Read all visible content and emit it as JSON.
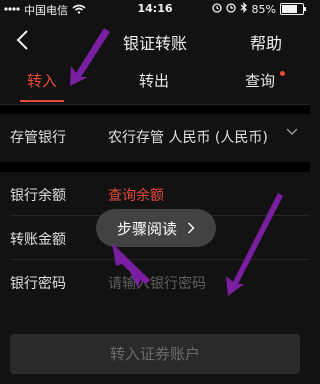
{
  "status_bar": {
    "carrier": "中国电信",
    "time": "14:16",
    "battery_percent": "85%",
    "battery_level": 0.85,
    "icons": [
      "signal-bars-icon",
      "wifi-icon",
      "alarm-icon",
      "clock-icon",
      "bluetooth-icon",
      "battery-icon"
    ]
  },
  "nav": {
    "title": "银证转账",
    "help_label": "帮助",
    "back_icon": "chevron-left-icon"
  },
  "tabs": [
    {
      "label": "转入",
      "active": true
    },
    {
      "label": "转出",
      "active": false
    },
    {
      "label": "查询",
      "active": false,
      "badge_dot": true
    }
  ],
  "form": {
    "bank": {
      "label": "存管银行",
      "value": "农行存管 人民币 (人民币)"
    },
    "balance": {
      "label": "银行余额",
      "value": "查询余额"
    },
    "amount": {
      "label": "转账金额",
      "placeholder": ""
    },
    "password": {
      "label": "银行密码",
      "placeholder": "请输入银行密码"
    }
  },
  "overlay_pill": {
    "label": "步骤阅读"
  },
  "submit_label": "转入证券账户",
  "colors": {
    "background": "#121212",
    "accent_red": "#e64b3c",
    "annotation_arrow": "#8e24aa"
  }
}
